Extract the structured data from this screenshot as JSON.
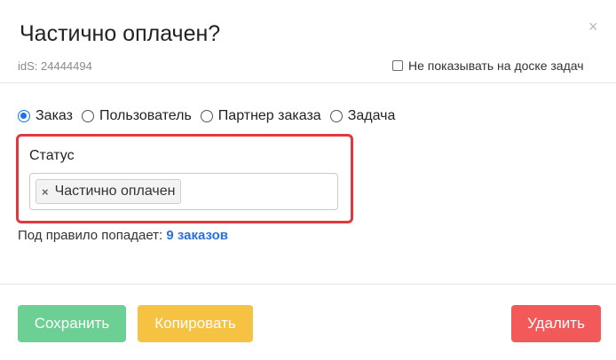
{
  "dialog": {
    "title": "Частично оплачен?",
    "close_glyph": "×",
    "ids_label": "idS: 24444494",
    "hide_checkbox": {
      "label": "Не показывать на доске задач",
      "checked": false
    }
  },
  "scope_radios": [
    {
      "label": "Заказ",
      "checked": true
    },
    {
      "label": "Пользователь",
      "checked": false
    },
    {
      "label": "Партнер заказа",
      "checked": false
    },
    {
      "label": "Задача",
      "checked": false
    }
  ],
  "status_field": {
    "label": "Статус",
    "selected_chip": "Частично оплачен",
    "chip_remove_glyph": "×",
    "highlight_color": "#e0383c"
  },
  "rule_info": {
    "prefix": "Под правило попадает:",
    "link_text": "9 заказов"
  },
  "buttons": {
    "save": "Сохранить",
    "copy": "Копировать",
    "delete": "Удалить"
  },
  "colors": {
    "save": "#6ccf93",
    "copy": "#f5c242",
    "delete": "#f25a5a",
    "radio_accent": "#1a73e8",
    "link": "#2a6fdb"
  },
  "icons": {
    "close": "close-icon",
    "chip_remove": "remove-chip-icon"
  }
}
